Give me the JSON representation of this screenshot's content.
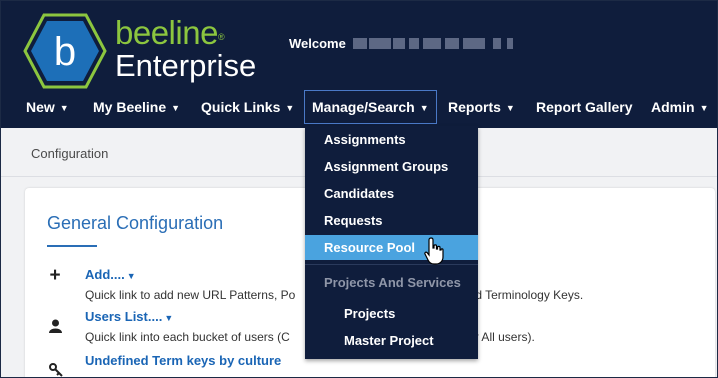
{
  "brand": {
    "top": "beeline",
    "trademark": "®",
    "bottom": "Enterprise",
    "logo_letter": "b",
    "green": "#8cc63f",
    "navy": "#0f1d3c"
  },
  "welcome": "Welcome",
  "nav": [
    {
      "label": "New"
    },
    {
      "label": "My Beeline"
    },
    {
      "label": "Quick Links"
    },
    {
      "label": "Manage/Search"
    },
    {
      "label": "Reports"
    },
    {
      "label": "Report Gallery"
    },
    {
      "label": "Admin"
    }
  ],
  "breadcrumb": "Configuration",
  "card": {
    "title": "General Configuration",
    "rows": [
      {
        "link": "Add....",
        "desc": "Quick link to add new URL Patterns, Po",
        "desc_tail": "rts and Terminology Keys.",
        "icon": "plus-icon"
      },
      {
        "link": "Users List....",
        "desc": "Quick link into each bucket of users (C",
        "desc_tail": "r All users).",
        "icon": "user-icon"
      },
      {
        "link": "Undefined Term keys by culture",
        "icon": "key-icon"
      }
    ]
  },
  "dropdown": {
    "items": [
      "Assignments",
      "Assignment Groups",
      "Candidates",
      "Requests",
      "Resource Pool"
    ],
    "hovered": "Resource Pool",
    "hover_color": "#4aa3df",
    "section_heading": "Projects And Services",
    "sub_items": [
      "Projects",
      "Master Project"
    ]
  }
}
